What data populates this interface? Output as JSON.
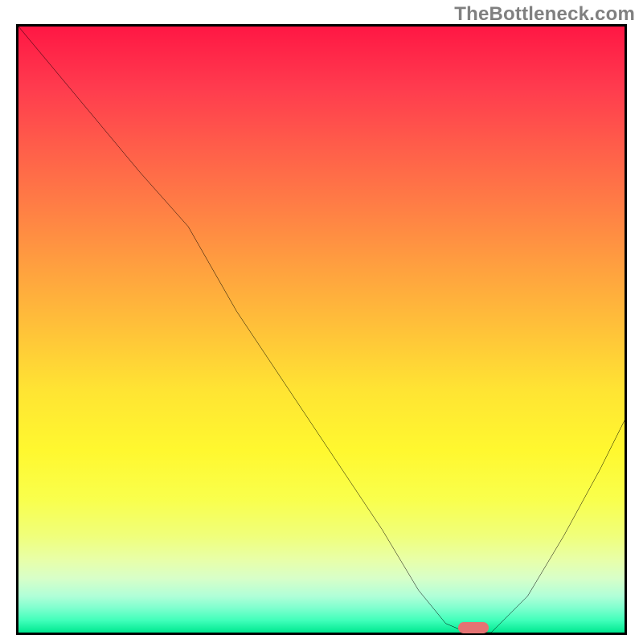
{
  "watermark": "TheBottleneck.com",
  "chart_data": {
    "type": "line",
    "title": "",
    "xlabel": "",
    "ylabel": "",
    "xlim": [
      0,
      100
    ],
    "ylim": [
      0,
      100
    ],
    "grid": false,
    "legend": false,
    "annotations": [],
    "series": [
      {
        "name": "bottleneck-curve",
        "color": "#000000",
        "x": [
          0,
          10,
          20,
          28,
          36,
          44,
          52,
          60,
          66,
          70.5,
          74,
          78,
          84,
          90,
          96,
          100
        ],
        "y": [
          100,
          88,
          76,
          67,
          53,
          41,
          29,
          17,
          7,
          1.5,
          0,
          0,
          6,
          16,
          27,
          35
        ]
      }
    ],
    "markers": [
      {
        "name": "optimal-marker",
        "x": 75,
        "y": 0.8,
        "color": "#e57373"
      }
    ],
    "gradient_stops": [
      {
        "pos": 0,
        "color": "#ff1744"
      },
      {
        "pos": 50,
        "color": "#ffc239"
      },
      {
        "pos": 78,
        "color": "#f9ff4c"
      },
      {
        "pos": 100,
        "color": "#00e890"
      }
    ]
  }
}
